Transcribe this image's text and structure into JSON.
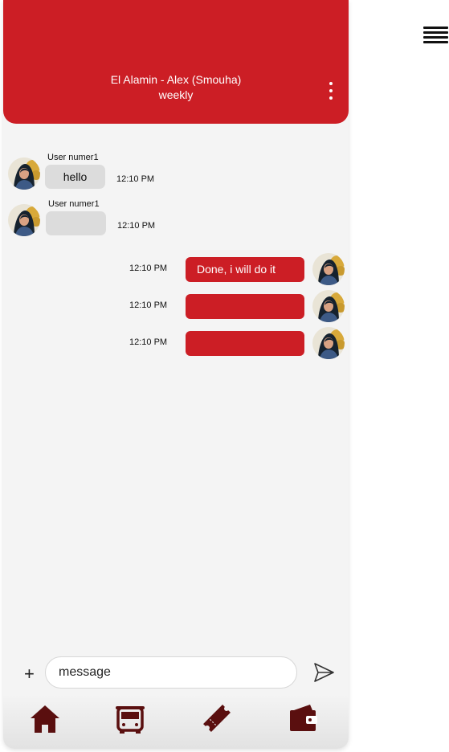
{
  "header": {
    "route": "El Alamin - Alex (Smouha)",
    "frequency": "weekly"
  },
  "messages_incoming": [
    {
      "sender": "User numer1",
      "text": "hello",
      "time": "12:10 PM"
    },
    {
      "sender": "User numer1",
      "text": "",
      "time": "12:10 PM"
    }
  ],
  "messages_outgoing": [
    {
      "text": "Done, i will do it",
      "time": "12:10 PM"
    },
    {
      "text": "",
      "time": "12:10 PM"
    },
    {
      "text": "",
      "time": "12:10 PM"
    }
  ],
  "composer": {
    "placeholder": "message",
    "add_icon": "plus-icon",
    "send_icon": "send-icon"
  },
  "nav": [
    {
      "icon": "home-icon"
    },
    {
      "icon": "bus-icon"
    },
    {
      "icon": "ticket-icon"
    },
    {
      "icon": "wallet-icon"
    }
  ],
  "menu_icon": "hamburger-menu-icon",
  "colors": {
    "brand_red": "#cc1e25",
    "incoming_bubble": "#dcdcdc",
    "background": "#f4f4f4",
    "nav_icon": "#5a0f0f"
  }
}
